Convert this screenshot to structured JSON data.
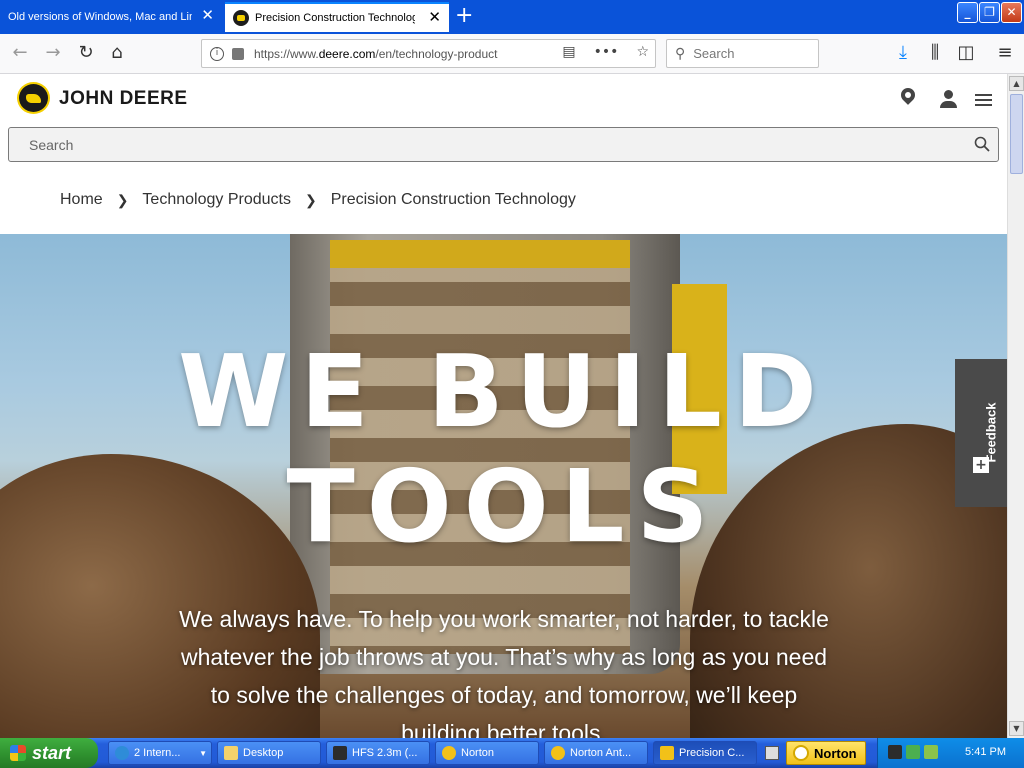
{
  "browser": {
    "tabs": [
      {
        "title": "Old versions of Windows, Mac and Lin",
        "active": false
      },
      {
        "title": "Precision Construction Technology",
        "active": true
      }
    ],
    "url_prefix": "https://www.",
    "url_domain": "deere.com",
    "url_path": "/en/technology-product",
    "search_placeholder": "Search"
  },
  "header": {
    "brand": "JOHN DEERE",
    "search_placeholder": "Search"
  },
  "breadcrumb": [
    "Home",
    "Technology Products",
    "Precision Construction Technology"
  ],
  "hero": {
    "line1": "WE BUILD",
    "line2": "TOOLS",
    "body": "We always have. To help you work smarter, not harder, to tackle whatever the job throws at you. That’s why as long as you need to solve the challenges of today, and tomorrow, we’ll keep building better tools."
  },
  "feedback": {
    "label": "Feedback",
    "plus": "+"
  },
  "taskbar": {
    "start": "start",
    "buttons": [
      {
        "label": "2 Intern...",
        "icon_color": "#2e8cd8"
      },
      {
        "label": "Desktop",
        "icon_color": "#f4d26b"
      },
      {
        "label": "HFS 2.3m (...",
        "icon_color": "#2c2c2c"
      },
      {
        "label": "Norton",
        "icon_color": "#f2c118"
      },
      {
        "label": "Norton Ant...",
        "icon_color": "#f2c118"
      },
      {
        "label": "Precision C...",
        "icon_color": "#f2c118"
      }
    ],
    "norton_label": "Norton",
    "clock": "5:41 PM"
  },
  "colors": {
    "jd_yellow": "#f5d000",
    "jd_green": "#367c2b",
    "xp_blue": "#245edb"
  }
}
